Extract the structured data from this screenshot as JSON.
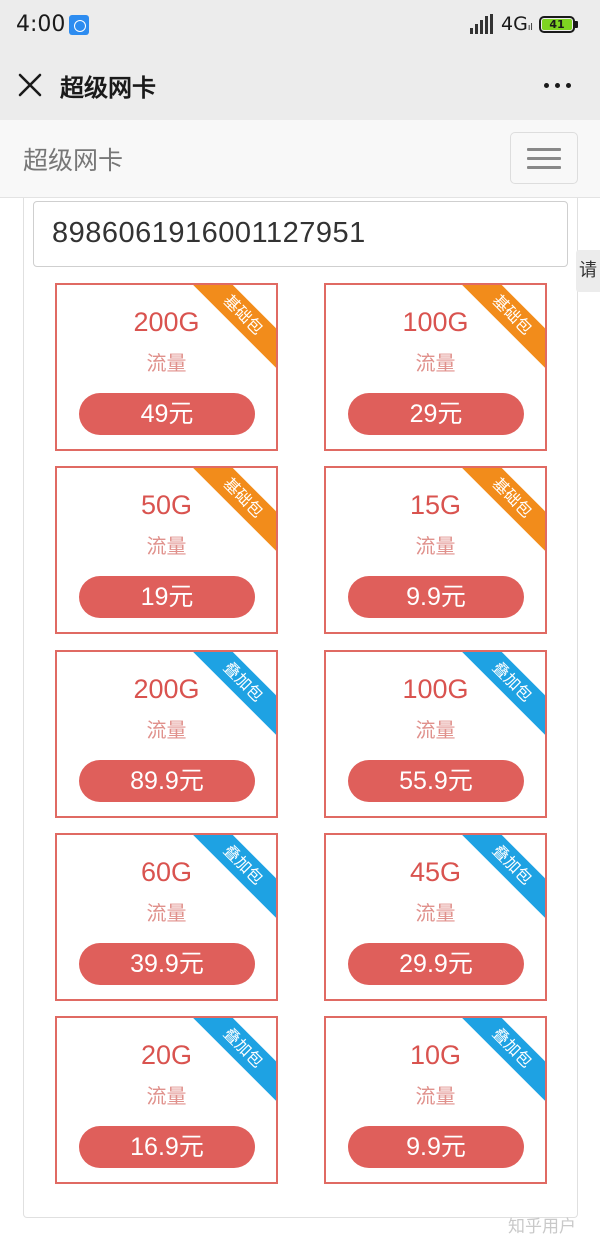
{
  "status_bar": {
    "time": "4:00",
    "network": "4G",
    "network_sub": "ıl",
    "battery": "41",
    "icons": [
      "app-notification-icon",
      "signal-icon",
      "battery-icon"
    ]
  },
  "title_bar": {
    "title": "超级网卡",
    "close_icon": "close-icon",
    "more_icon": "more-icon"
  },
  "navbar": {
    "brand": "超级网卡",
    "menu_icon": "hamburger-menu-icon"
  },
  "card_number": "8986061916001127951",
  "side_tab_label": "请",
  "colors": {
    "card_border": "#e06a63",
    "price_button": "#df5f5b",
    "ribbon_base": "#f28c1b",
    "ribbon_addon": "#1ea2e3"
  },
  "packages": [
    {
      "size": "200G",
      "unit": "流量",
      "price": "49元",
      "tag": "基础包",
      "tag_type": "base"
    },
    {
      "size": "100G",
      "unit": "流量",
      "price": "29元",
      "tag": "基础包",
      "tag_type": "base"
    },
    {
      "size": "50G",
      "unit": "流量",
      "price": "19元",
      "tag": "基础包",
      "tag_type": "base"
    },
    {
      "size": "15G",
      "unit": "流量",
      "price": "9.9元",
      "tag": "基础包",
      "tag_type": "base"
    },
    {
      "size": "200G",
      "unit": "流量",
      "price": "89.9元",
      "tag": "叠加包",
      "tag_type": "addon"
    },
    {
      "size": "100G",
      "unit": "流量",
      "price": "55.9元",
      "tag": "叠加包",
      "tag_type": "addon"
    },
    {
      "size": "60G",
      "unit": "流量",
      "price": "39.9元",
      "tag": "叠加包",
      "tag_type": "addon"
    },
    {
      "size": "45G",
      "unit": "流量",
      "price": "29.9元",
      "tag": "叠加包",
      "tag_type": "addon"
    },
    {
      "size": "20G",
      "unit": "流量",
      "price": "16.9元",
      "tag": "叠加包",
      "tag_type": "addon"
    },
    {
      "size": "10G",
      "unit": "流量",
      "price": "9.9元",
      "tag": "叠加包",
      "tag_type": "addon"
    }
  ],
  "watermark": "知乎用户"
}
